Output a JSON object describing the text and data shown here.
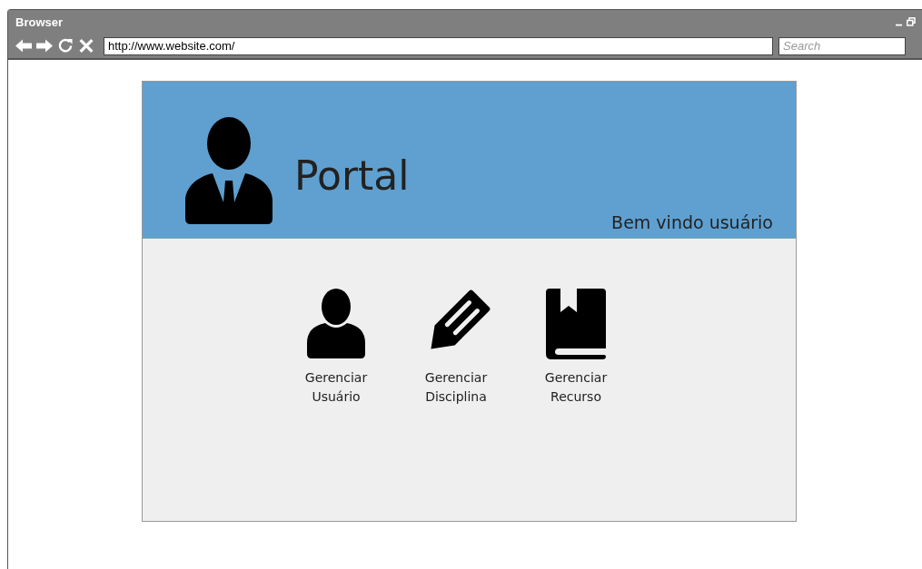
{
  "window": {
    "title": "Browser"
  },
  "toolbar": {
    "url": "http://www.website.com/",
    "search_placeholder": "Search"
  },
  "header": {
    "title": "Portal",
    "welcome": "Bem vindo usuário"
  },
  "menu": [
    {
      "kind": "user",
      "label": "Gerenciar Usuário"
    },
    {
      "kind": "pencil",
      "label": "Gerenciar Disciplina"
    },
    {
      "kind": "book",
      "label": "Gerenciar Recurso"
    }
  ]
}
